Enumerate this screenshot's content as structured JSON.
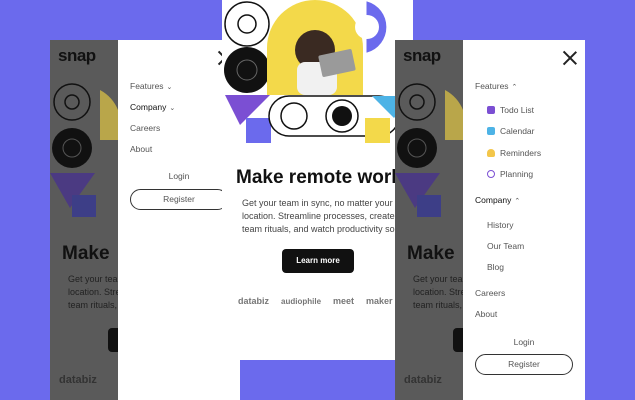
{
  "colors": {
    "background": "#6B6AED",
    "accent_purple": "#7B4FD3",
    "accent_yellow": "#F3D94A",
    "accent_cyan": "#4DB3E6"
  },
  "left_phone": {
    "logo": "snap",
    "headline": "Make",
    "body_lines": [
      "Get your team",
      "location. Stre",
      "team rituals, a"
    ],
    "brand": "databiz",
    "menu": {
      "items": [
        {
          "label": "Features",
          "icon": "chevron-down-icon"
        },
        {
          "label": "Company",
          "icon": "chevron-down-icon"
        },
        {
          "label": "Careers"
        },
        {
          "label": "About"
        }
      ],
      "login": "Login",
      "register": "Register"
    }
  },
  "center_phone": {
    "headline": "Make remote work",
    "body_lines": [
      "Get your team in sync, no matter your",
      "location. Streamline processes, create",
      "team rituals, and watch productivity soar."
    ],
    "cta": "Learn more",
    "brands": [
      "databiz",
      "audiophile",
      "meet",
      "maker"
    ]
  },
  "right_phone": {
    "logo": "snap",
    "headline": "Make",
    "body_lines": [
      "Get your team",
      "location. Stre",
      "team rituals, a"
    ],
    "brand": "databiz",
    "menu": {
      "features": "Features",
      "feature_items": [
        {
          "label": "Todo List",
          "icon": "calendar-icon",
          "color": "#7B4FD3"
        },
        {
          "label": "Calendar",
          "icon": "calendar-icon",
          "color": "#4DB3E6"
        },
        {
          "label": "Reminders",
          "icon": "bell-icon",
          "color": "#F3C64A"
        },
        {
          "label": "Planning",
          "icon": "clock-icon",
          "color": "#7B4FD3"
        }
      ],
      "company": "Company",
      "company_items": [
        "History",
        "Our Team",
        "Blog"
      ],
      "careers": "Careers",
      "about": "About",
      "login": "Login",
      "register": "Register"
    }
  }
}
